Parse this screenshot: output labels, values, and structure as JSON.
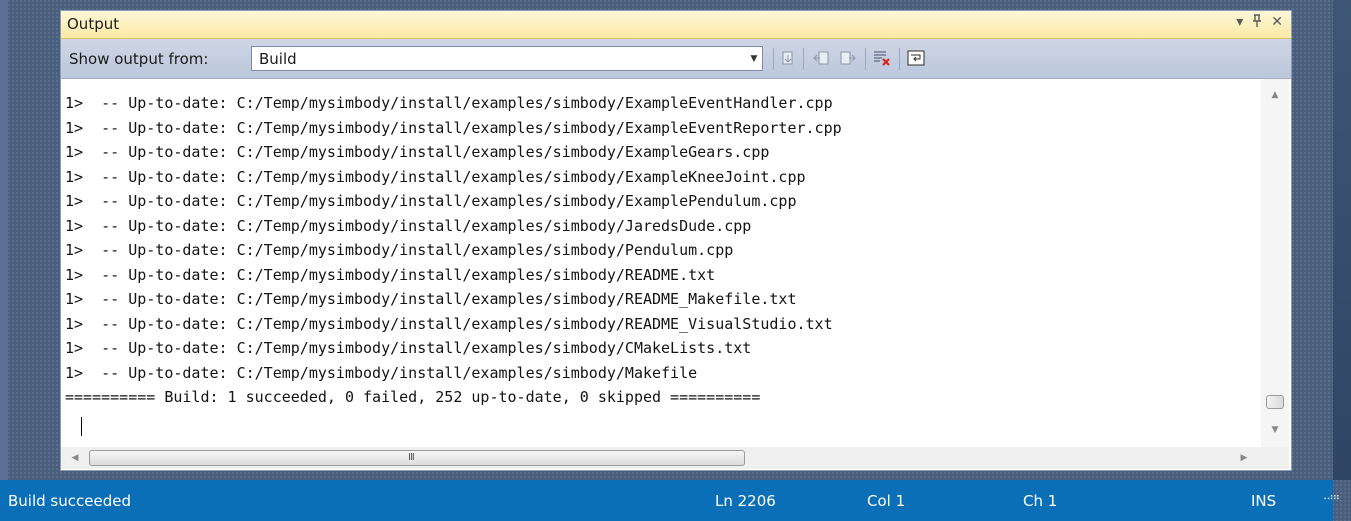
{
  "panel": {
    "title": "Output",
    "controls": {
      "dropdown_glyph": "▾",
      "pin_glyph": "ᚁ",
      "close_glyph": "✕"
    }
  },
  "toolbar": {
    "show_output_label": "Show output from:",
    "source_selected": "Build"
  },
  "output_lines": [
    "1>  -- Up-to-date: C:/Temp/mysimbody/install/examples/simbody/ExampleEventHandler.cpp",
    "1>  -- Up-to-date: C:/Temp/mysimbody/install/examples/simbody/ExampleEventReporter.cpp",
    "1>  -- Up-to-date: C:/Temp/mysimbody/install/examples/simbody/ExampleGears.cpp",
    "1>  -- Up-to-date: C:/Temp/mysimbody/install/examples/simbody/ExampleKneeJoint.cpp",
    "1>  -- Up-to-date: C:/Temp/mysimbody/install/examples/simbody/ExamplePendulum.cpp",
    "1>  -- Up-to-date: C:/Temp/mysimbody/install/examples/simbody/JaredsDude.cpp",
    "1>  -- Up-to-date: C:/Temp/mysimbody/install/examples/simbody/Pendulum.cpp",
    "1>  -- Up-to-date: C:/Temp/mysimbody/install/examples/simbody/README.txt",
    "1>  -- Up-to-date: C:/Temp/mysimbody/install/examples/simbody/README_Makefile.txt",
    "1>  -- Up-to-date: C:/Temp/mysimbody/install/examples/simbody/README_VisualStudio.txt",
    "1>  -- Up-to-date: C:/Temp/mysimbody/install/examples/simbody/CMakeLists.txt",
    "1>  -- Up-to-date: C:/Temp/mysimbody/install/examples/simbody/Makefile",
    "========== Build: 1 succeeded, 0 failed, 252 up-to-date, 0 skipped =========="
  ],
  "hscroll_grip": "III",
  "statusbar": {
    "message": "Build succeeded",
    "line": "Ln 2206",
    "col": "Col 1",
    "ch": "Ch 1",
    "mode": "INS"
  },
  "colors": {
    "statusbar": "#0a6fb7",
    "titlebar": "#fbe9a3",
    "toolbar": "#bcc7dc"
  }
}
